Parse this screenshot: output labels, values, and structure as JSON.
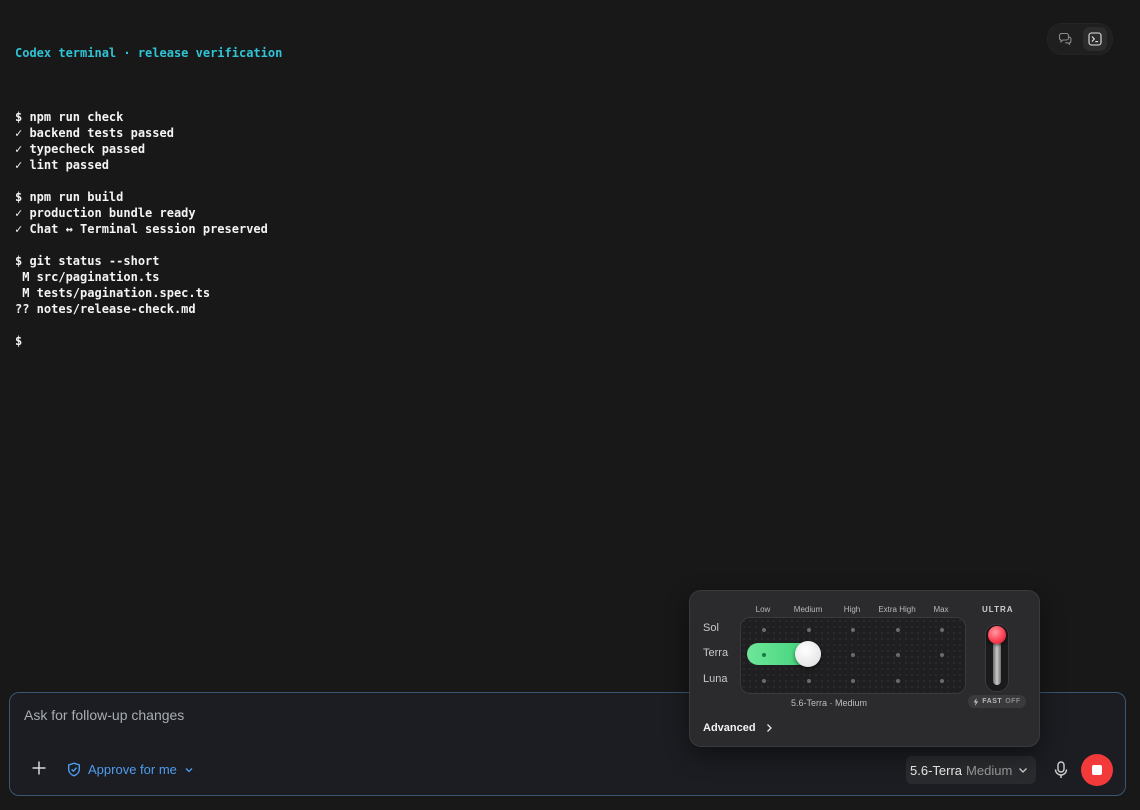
{
  "terminal": {
    "title": "Codex terminal · release verification",
    "lines": [
      "",
      "$ npm run check",
      "✓ backend tests passed",
      "✓ typecheck passed",
      "✓ lint passed",
      "",
      "$ npm run build",
      "✓ production bundle ready",
      "✓ Chat ↔ Terminal session preserved",
      "",
      "$ git status --short",
      " M src/pagination.ts",
      " M tests/pagination.spec.ts",
      "?? notes/release-check.md",
      "",
      "$"
    ]
  },
  "view_toggle": {
    "items": [
      {
        "icon": "chat-bubbles-icon",
        "active": false
      },
      {
        "icon": "terminal-icon",
        "active": true
      }
    ]
  },
  "popover": {
    "columns": [
      "Low",
      "Medium",
      "High",
      "Extra High",
      "Max"
    ],
    "rows": [
      "Sol",
      "Terra",
      "Luna"
    ],
    "selected_row": "Terra",
    "selected_column": "Medium",
    "selection_caption": "5.6-Terra · Medium",
    "ultra_label": "ULTRA",
    "fast_label": "FAST",
    "fast_state": "OFF",
    "advanced_label": "Advanced",
    "slider_color": "#4fd882",
    "ultra_color": "#ff3f52"
  },
  "composer": {
    "placeholder": "Ask for follow-up changes",
    "approve_label": "Approve for me",
    "model_name": "5.6-Terra",
    "model_level": "Medium",
    "accent": "#4f9cf0",
    "stop_color": "#f23a3a"
  }
}
